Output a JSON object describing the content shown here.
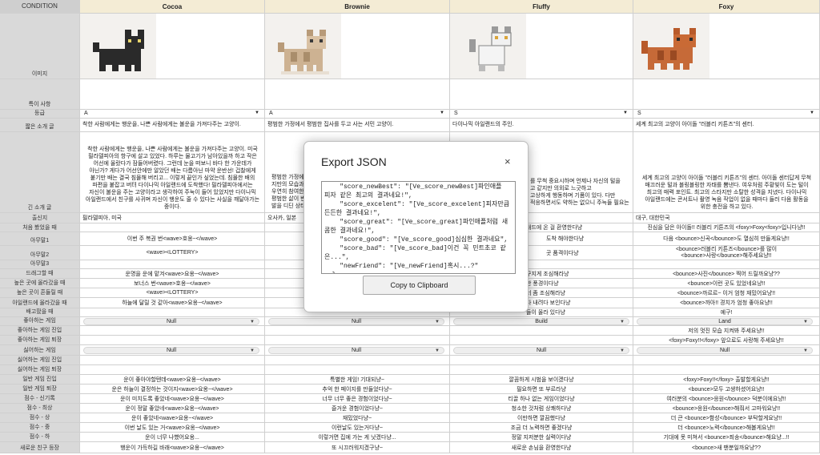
{
  "header": {
    "condition": "CONDITION",
    "cats": [
      "Cocoa",
      "Brownie",
      "Fluffy",
      "Foxy"
    ]
  },
  "labels": {
    "image": "이미지",
    "special": "특이 사항",
    "grade": "등급",
    "short_intro": "짧은 소개 글",
    "long_intro": "긴 소개 글",
    "origin": "출신지",
    "first_meet": "처음 봤었을 때",
    "random1": "아무말1",
    "random2": "아무말2",
    "random3": "아무말3",
    "drag": "드래그할 때",
    "high_place": "높은 곳에 올라갔을 때",
    "high_shake": "높은 곳이 흔들릴 때",
    "island_up": "아일랜드에 올라갔을 때",
    "hungry": "배고팠을 때",
    "fav_game": "좋아하는 게임",
    "fav_enter": "좋아하는 게임 진입",
    "fav_exit": "좋아하는 게임 퇴장",
    "hate_game": "싫어하는 게임",
    "hate_enter": "싫어하는 게임 진입",
    "hate_exit": "싫어하는 게임 퇴장",
    "normal_enter": "일반 게임 진입",
    "normal_exit": "일반 게임 퇴장",
    "score_newbest": "점수 - 신기록",
    "score_best": "점수 - 최상",
    "score_great": "점수 - 상",
    "score_good": "점수 - 중",
    "score_bad": "점수 - 하",
    "new_friend": "새로운 친구 등장"
  },
  "cocoa": {
    "grade": "A",
    "short": "착한 사람에게는 행운을, 나쁜 사람에게는 불운을 가져다주는 고양이.",
    "long_lines": [
      "착한 사람에게는 행운을, 나쁜 사람에게는 불운을 가져다주는 고양이. 미국",
      "필라델피아의 항구에 살고 있었다. 하루는 물고기가 남아있을까 하고 작은",
      "어선에 올랐다가 잠들어버렸다. 그런데 눈을 떠보니 바다 한 가운데가",
      "아닌가? 게다가 어선안에만 알았던 배는 다름아닌 마약 운반선! 겁찰에게",
      "붙기만 배는 결국 침몰해 버리고... 이렇게 끝인가 싶었는데. 침몰한 배의",
      "파편을 붙잡고 버텨 다이나믹 아일랜드에 도착했다! 필라델피아에서는",
      "자신이 불운을 주는 고양이라고 생각하여 주눅이 들어 있었지만 다이나믹",
      "아일랜드에서 친구를 사귀며 자신이 행운도 줄 수 있다는 사실을 깨달아가는",
      "중이다."
    ],
    "origin": "필라델피아, 미국",
    "random1": "이번 주 복권 번<wave>호옹~</wave>",
    "random2": "<wave><LOTTERY>",
    "drag": "운명을 운에 맡겨<wave>요옹~</wave>",
    "high_place": "보너스 번<wave>호옹~</wave>",
    "high_shake": "<wave><LOTTERY>",
    "island_up": "하늘에 달릴 것 같아<wave>요옹~</wave>",
    "fav_game": "Null",
    "hate_game": "Null",
    "normal_enter": "운이 좋아야할텐데<wave>요옹~</wave>",
    "normal_exit": "운은 하늘이 결정하는 것이지<wave>요옹~</wave>",
    "score_newbest": "운이 미치도록 좋았네<wave>요옹~</wave>",
    "score_best": "운이 정말 좋았네<wave>요옹~</wave>",
    "score_great": "운이 좋았네<wave>요옹~</wave>",
    "score_good": "이번 날도 있는 거<wave>요옹~</wave>",
    "score_bad": "운이 너무 나빴어요옹...",
    "new_friend": "행운이 가득하길 바래<wave>요옹~</wave>"
  },
  "brownie": {
    "grade": "A",
    "short": "평범한 가정에서 평범한 집사를 두고 사는 서민 고양이.",
    "long_lines": [
      "평범한 가정에",
      "지만의 모습과 i",
      "우연히 참여한",
      "평범한 삶이 변",
      "발을 디딘 상태"
    ],
    "origin": "오사카, 일본",
    "fav_game": "Null",
    "hate_game": "Null",
    "normal_enter": "특별한 게임! 기대되냥~",
    "normal_exit": "추억 한 페이지를 만들었다냥~",
    "score_newbest": "너무 너무 좋은 경험이었다냥~",
    "score_best": "즐거운 경험이었다냥~",
    "score_great": "재밌었다냥~",
    "score_good": "이런날도 있는거다냥~",
    "score_bad": "이렇거면 집에 가는 게 낫겠다냥...",
    "new_friend": "또 시끄러워지겠구냥~"
  },
  "fluffy": {
    "grade": "S",
    "short": "다이나믹 아일랜드의 주인.",
    "long_lines": [
      "를 무척 중요시하며 언제나 자신의 털을",
      "고 같지만 의외로 느긋하고",
      "고상하게 행동하며 기품이 있다. 다만",
      "적응하면서도 약하는 없으니 주늑들 필요는"
    ],
    "first_meet": "래드에 온 걸 환영한다냥",
    "random1": "도착 해야한다냥",
    "random2": "곳 품격이다냥",
    "drag": "구지게 조심해라냥",
    "high_place": "한 풍경이다냥",
    "high_shake": "너 좀 조심해라냥",
    "island_up": "다 내려다 보인다냥",
    "hungry": "들이 올라 있다냥",
    "fav_game": "Build",
    "hate_game": "Null",
    "normal_enter": "깔끔하게 시범을 보이겠다냥",
    "normal_exit": "필요하면 또 부르라냥",
    "score_newbest": "티끌 하나 없는 게임이었다냥",
    "score_best": "청소한 것처럼 상쾌하다냥",
    "score_great": "이만하면 깔끔했다냥",
    "score_good": "조금 더 노력하면 좋겠다냥",
    "score_bad": "정말 지저분한 실력이다냥",
    "new_friend": "새로운 손님을 환영한다냥"
  },
  "foxy": {
    "grade": "S",
    "short": "세계 최고의 고양이 아이돌 \"러블리 키튼즈\"의 센터.",
    "long_lines": [
      "세계 최고의 고양이 아이돌 \"러블리 키튼즈\"의 센터. 아이돌 센터답게 무척",
      "매끄러운 털과 블링블링한 자태를 뽐낸다. 여우처럼 주황빛이 도는 털이",
      "최고의 매력 포인트. 최고의 스타지만 소탈한 성격을 지녔다. 다이나믹",
      "아일랜드에는 콘서트나 촬영 녹음 작업이 없을 때마다 들러 다음 활동을",
      "위한 충전을 하고 있다."
    ],
    "origin": "대구, 대한민국",
    "first_meet": "진심을 담은 아이돌!! 러블리 키튼즈의 <foxy>Foxy<foxy>입니다냥!!",
    "random1": "다음 <bounce>신곡</bounce>도 열심히 만들게요냥!!",
    "random2": "<bounce>러블리 키튼즈</bounce>를 많이",
    "random2b": "<bounce>사랑</bounce>해주세요냥!!",
    "drag": "<bounce>사진</bounce> 찍어 드릴까요냥??",
    "high_place": "<bounce>이런 곳도 있었네요냥!!",
    "high_shake": "<bounce>까르르~ 이거 엄청 재밌어요냥!!",
    "island_up": "<bounce>까아!! 경치가 엄청 좋아요냥!!",
    "hungry": "예구!",
    "fav_game": "Land",
    "fav_enter": "저의 멋진 모습 지켜봐 주세요냥!!",
    "fav_exit": "<foxy>Foxy!!</foxy> 앞으로도 사랑해 주세요냥!!",
    "hate_game": "Null",
    "normal_enter": "<foxy>Foxy!!</foxy> 출발할게요냥!!",
    "normal_exit": "<bounce>모두 고생하셨어요냥!!",
    "score_newbest": "여러분의 <bounce>응원</bounce> 덕분이에요냥!!",
    "score_best": "<bounce>응원</bounce>해줘서 고마워요냥!!",
    "score_great": "더 큰 <bounce>함성</bounce> 부탁할게요냥!!",
    "score_good": "더 <bounce>노력</bounce>해볼게요냥!!",
    "score_bad": "기대에 못 미쳐서 <bounce>죄송</bounce>해요냥...!!",
    "new_friend": "<bounce>새 팬분일까요냥??"
  },
  "dialog": {
    "title": "Export JSON",
    "close": "×",
    "json_text": "    \"score_newBest\": \"[Ve_score_newBest]파인애플\n피자 같은 최고의 결과네요!\",\n    \"score_excelent\": \"[Ve_score_excelent]피자만큼\n든든한 결과네요!\",\n    \"score_great\": \"[Ve_score_great]파인애플처럼 새\n콤한 결과네요!\",\n    \"score_good\": \"[Ve_score_good]심심한 결과네요\",\n    \"score_bad\": \"[Ve_score_bad]이건 꼭 민트초코 같\n은...\",\n    \"newFriend\": \"[Ve_newFriend]혹시...?\"\n  }\n}",
    "button": "Copy to Clipboard"
  }
}
